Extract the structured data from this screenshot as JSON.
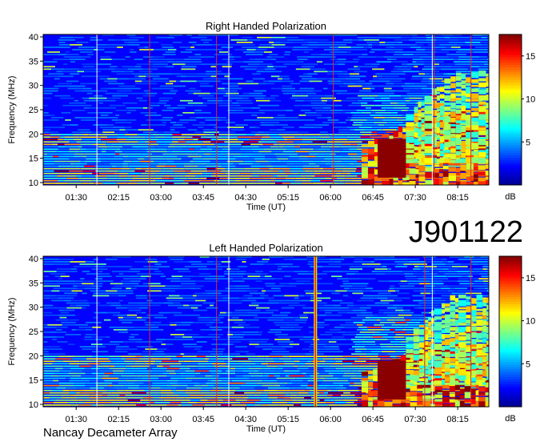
{
  "figure": {
    "event_id": "J901122",
    "footer": "Nancay Decameter Array"
  },
  "colors": {
    "background_low": "#0a1aa8",
    "colormap": [
      "#00008f",
      "#0000ff",
      "#0080ff",
      "#00ffff",
      "#80ff80",
      "#ffff00",
      "#ff8000",
      "#ff0000",
      "#800000"
    ],
    "marker_line": "#e03020",
    "white_line": "#ffffff"
  },
  "chart_data": [
    {
      "type": "heatmap",
      "title": "Right Handed Polarization",
      "xlabel": "Time (UT)",
      "ylabel": "Frequency (MHz)",
      "x_tick_labels": [
        "01:30",
        "02:15",
        "03:00",
        "03:45",
        "04:30",
        "05:15",
        "06:00",
        "06:45",
        "07:30",
        "08:15"
      ],
      "x_tick_minutes": [
        90,
        135,
        180,
        225,
        270,
        315,
        360,
        405,
        450,
        495
      ],
      "xlim_minutes": [
        55,
        528
      ],
      "y_ticks": [
        10,
        15,
        20,
        25,
        30,
        35,
        40
      ],
      "ylim": [
        9.5,
        40.5
      ],
      "colorbar": {
        "unit": "dB",
        "ticks": [
          5,
          10,
          15
        ],
        "range": [
          0,
          17.5
        ]
      },
      "white_time_lines_minutes": [
        112,
        252,
        468
      ],
      "marker_time_lines_minutes": [
        168,
        239,
        363,
        470,
        509
      ],
      "features": [
        {
          "t_start_minutes": 393,
          "t_end_minutes": 528,
          "f_low": 9.5,
          "f_high": 24,
          "db": 17
        },
        {
          "t_start_minutes": 440,
          "t_end_minutes": 528,
          "f_low": 14,
          "f_high": 32,
          "db": 12
        }
      ]
    },
    {
      "type": "heatmap",
      "title": "Left Handed Polarization",
      "xlabel": "Time (UT)",
      "ylabel": "Frequency (MHz)",
      "x_tick_labels": [
        "01:30",
        "02:15",
        "03:00",
        "03:45",
        "04:30",
        "05:15",
        "06:00",
        "06:45",
        "07:30",
        "08:15"
      ],
      "x_tick_minutes": [
        90,
        135,
        180,
        225,
        270,
        315,
        360,
        405,
        450,
        495
      ],
      "xlim_minutes": [
        55,
        528
      ],
      "y_ticks": [
        10,
        15,
        20,
        25,
        30,
        35,
        40
      ],
      "ylim": [
        9.5,
        40.5
      ],
      "colorbar": {
        "unit": "dB",
        "ticks": [
          5,
          10,
          15
        ],
        "range": [
          0,
          17.5
        ]
      },
      "white_time_lines_minutes": [
        112,
        252,
        468
      ],
      "marker_time_lines_minutes": [
        168,
        239,
        344,
        460,
        509
      ],
      "burst_line_minutes": 344,
      "features": [
        {
          "t_start_minutes": 393,
          "t_end_minutes": 528,
          "f_low": 9.5,
          "f_high": 22,
          "db": 17
        },
        {
          "t_start_minutes": 440,
          "t_end_minutes": 528,
          "f_low": 14,
          "f_high": 32,
          "db": 12
        }
      ]
    }
  ]
}
